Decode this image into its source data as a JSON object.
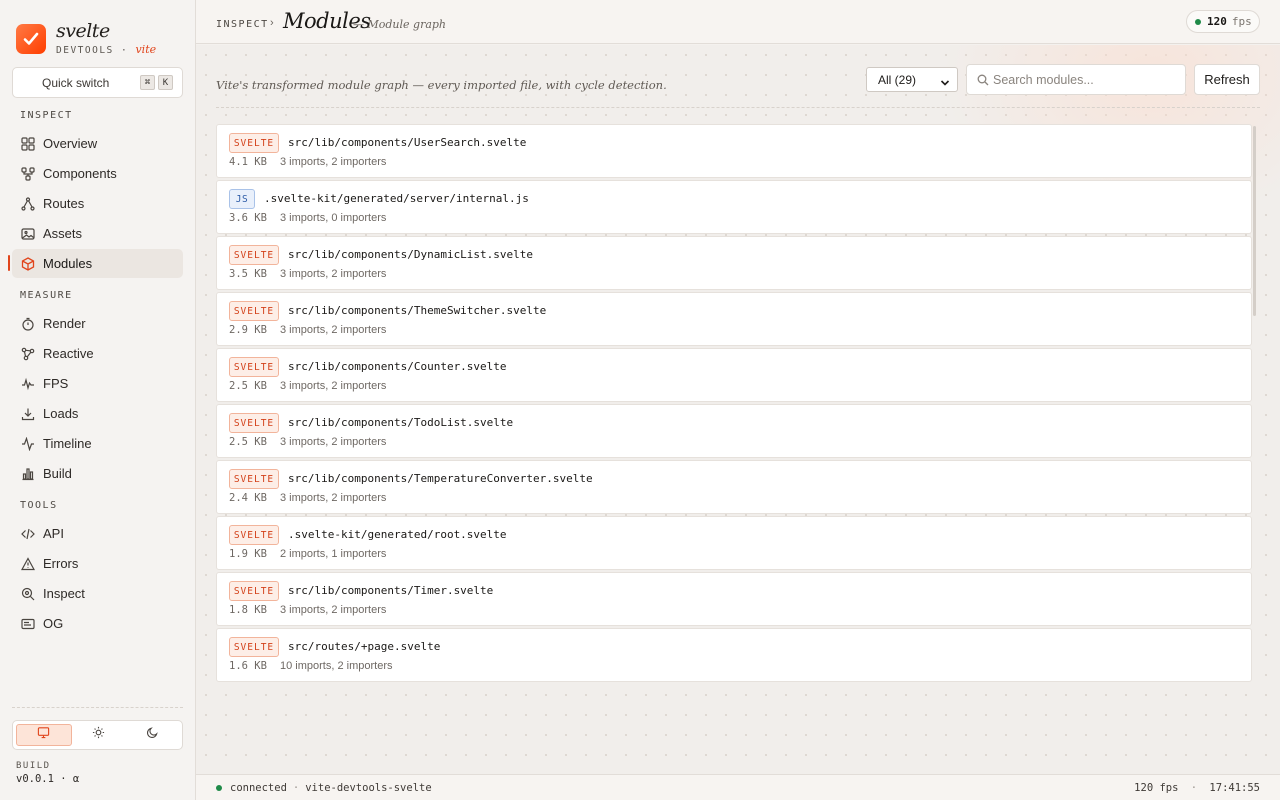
{
  "brand": {
    "name": "svelte",
    "sub": "DEVTOOLS",
    "sub_sep": "·",
    "sub_accent": "vite"
  },
  "quick_switch": {
    "label": "Quick switch",
    "keys": [
      "⌘",
      "K"
    ]
  },
  "nav": {
    "sections": [
      {
        "label": "INSPECT",
        "items": [
          {
            "label": "Overview",
            "icon": "grid-icon"
          },
          {
            "label": "Components",
            "icon": "component-tree-icon"
          },
          {
            "label": "Routes",
            "icon": "route-icon"
          },
          {
            "label": "Assets",
            "icon": "image-icon"
          },
          {
            "label": "Modules",
            "icon": "cube-icon",
            "active": true
          }
        ]
      },
      {
        "label": "MEASURE",
        "items": [
          {
            "label": "Render",
            "icon": "stopwatch-icon"
          },
          {
            "label": "Reactive",
            "icon": "graph-icon"
          },
          {
            "label": "FPS",
            "icon": "pulse-icon"
          },
          {
            "label": "Loads",
            "icon": "download-icon"
          },
          {
            "label": "Timeline",
            "icon": "activity-icon"
          },
          {
            "label": "Build",
            "icon": "bar-chart-icon"
          }
        ]
      },
      {
        "label": "TOOLS",
        "items": [
          {
            "label": "API",
            "icon": "code-icon"
          },
          {
            "label": "Errors",
            "icon": "warning-icon"
          },
          {
            "label": "Inspect",
            "icon": "crosshair-icon"
          },
          {
            "label": "OG",
            "icon": "card-icon"
          }
        ]
      }
    ]
  },
  "theme": {
    "options": [
      "monitor-icon",
      "sun-icon",
      "moon-icon"
    ],
    "selected": "monitor-icon"
  },
  "build": {
    "label": "BUILD",
    "value": "v0.0.1 · α"
  },
  "header": {
    "breadcrumb": "INSPECT",
    "separator": "›",
    "title": "Modules",
    "subtitle": "— Module graph",
    "fps_value": "120",
    "fps_unit": "fps"
  },
  "toolbar": {
    "description": "Vite's transformed module graph — every imported file, with cycle detection.",
    "filter_selected": "All (29)",
    "search_placeholder": "Search modules...",
    "refresh_label": "Refresh"
  },
  "modules": [
    {
      "type": "SVELTE",
      "path": "src/lib/components/UserSearch.svelte",
      "size": "4.1 KB",
      "meta": "3 imports, 2 importers"
    },
    {
      "type": "JS",
      "path": ".svelte-kit/generated/server/internal.js",
      "size": "3.6 KB",
      "meta": "3 imports, 0 importers"
    },
    {
      "type": "SVELTE",
      "path": "src/lib/components/DynamicList.svelte",
      "size": "3.5 KB",
      "meta": "3 imports, 2 importers"
    },
    {
      "type": "SVELTE",
      "path": "src/lib/components/ThemeSwitcher.svelte",
      "size": "2.9 KB",
      "meta": "3 imports, 2 importers"
    },
    {
      "type": "SVELTE",
      "path": "src/lib/components/Counter.svelte",
      "size": "2.5 KB",
      "meta": "3 imports, 2 importers"
    },
    {
      "type": "SVELTE",
      "path": "src/lib/components/TodoList.svelte",
      "size": "2.5 KB",
      "meta": "3 imports, 2 importers"
    },
    {
      "type": "SVELTE",
      "path": "src/lib/components/TemperatureConverter.svelte",
      "size": "2.4 KB",
      "meta": "3 imports, 2 importers"
    },
    {
      "type": "SVELTE",
      "path": ".svelte-kit/generated/root.svelte",
      "size": "1.9 KB",
      "meta": "2 imports, 1 importers"
    },
    {
      "type": "SVELTE",
      "path": "src/lib/components/Timer.svelte",
      "size": "1.8 KB",
      "meta": "3 imports, 2 importers"
    },
    {
      "type": "SVELTE",
      "path": "src/routes/+page.svelte",
      "size": "1.6 KB",
      "meta": "10 imports, 2 importers"
    }
  ],
  "status": {
    "connection": "connected",
    "sep": "·",
    "project": "vite-devtools-svelte",
    "fps": "120 fps",
    "time": "17:41:55"
  },
  "colors": {
    "accent": "#e1451c",
    "svelte_badge": "#d3411a",
    "js_badge": "#2f5da8",
    "connected": "#1f8a48"
  }
}
